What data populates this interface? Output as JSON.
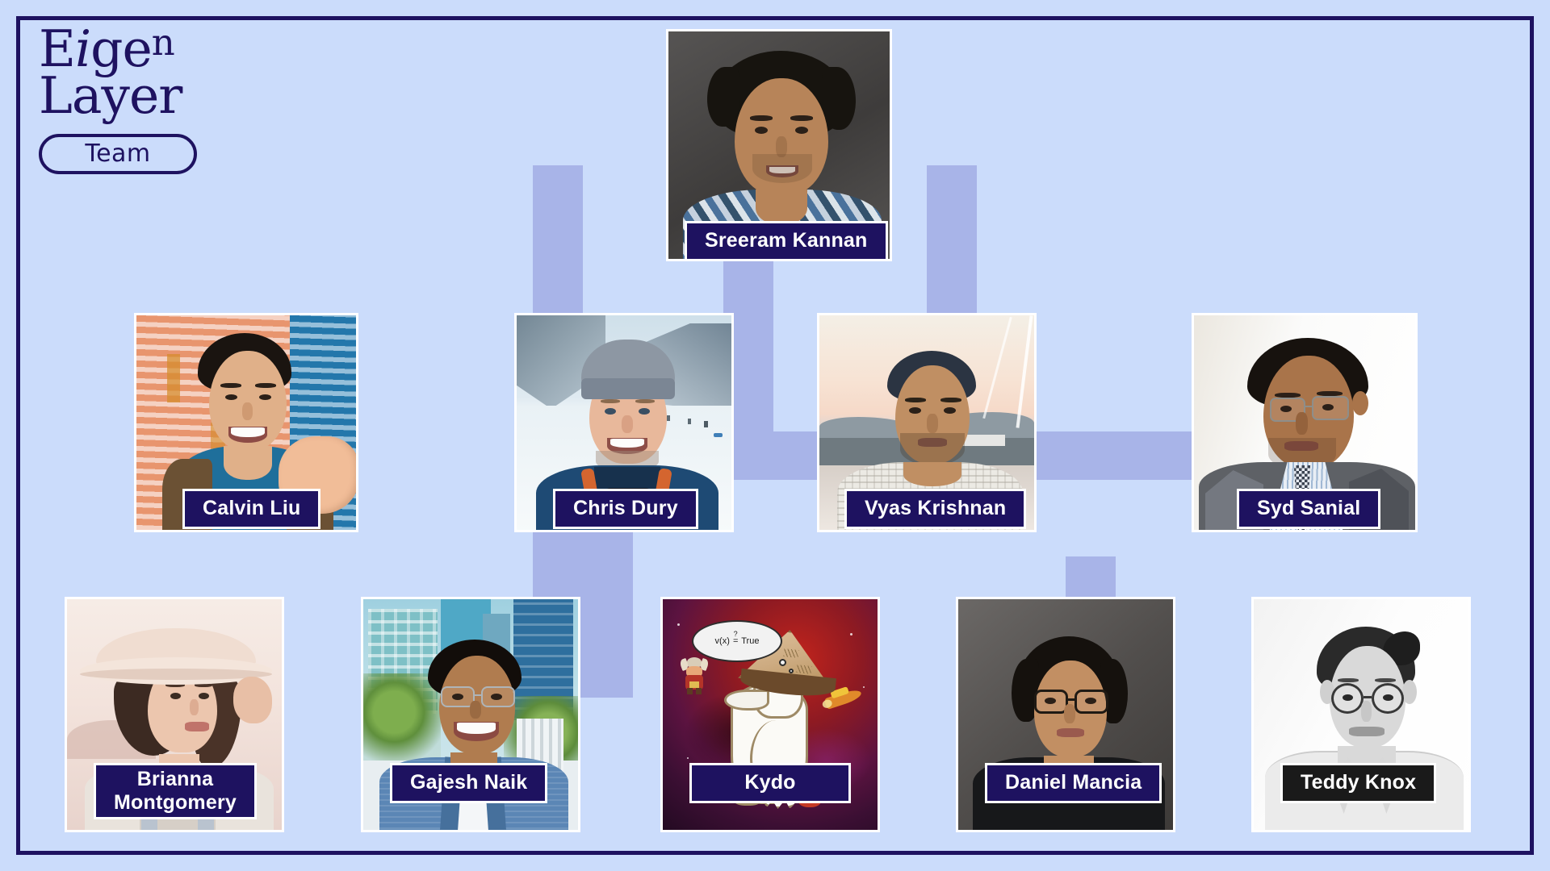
{
  "page": {
    "title": "EigenLayer Team",
    "background_color": "#cbdcfb",
    "frame_color": "#1e1260",
    "connector_color": "#a8b4e8",
    "nameplate_bg": "#1e1260",
    "nameplate_text_color": "#ffffff"
  },
  "logo": {
    "line1_part1": "E",
    "line1_italic_i": "i",
    "line1_part2": "ge",
    "line1_sup_n": "n",
    "line2_part1": "La",
    "line2_sup_y": "y",
    "line2_part2": "er",
    "pill_label": "Team"
  },
  "chart_data": {
    "type": "diagram",
    "title": "EigenLayer Team",
    "layout": "org-chart",
    "levels": 3,
    "nodes": [
      {
        "name": "Sreeram Kannan",
        "level": 1,
        "label_lines": [
          "Sreeram Kannan"
        ]
      },
      {
        "name": "Calvin Liu",
        "level": 2,
        "label_lines": [
          "Calvin Liu"
        ]
      },
      {
        "name": "Chris Dury",
        "level": 2,
        "label_lines": [
          "Chris Dury"
        ]
      },
      {
        "name": "Vyas Krishnan",
        "level": 2,
        "label_lines": [
          "Vyas Krishnan"
        ]
      },
      {
        "name": "Syd Sanial",
        "level": 2,
        "label_lines": [
          "Syd Sanial"
        ]
      },
      {
        "name": "Brianna Montgomery",
        "level": 3,
        "label_lines": [
          "Brianna",
          "Montgomery"
        ]
      },
      {
        "name": "Gajesh Naik",
        "level": 3,
        "label_lines": [
          "Gajesh Naik"
        ]
      },
      {
        "name": "Kydo",
        "level": 3,
        "label_lines": [
          "Kydo"
        ]
      },
      {
        "name": "Daniel Mancia",
        "level": 3,
        "label_lines": [
          "Daniel Mancia"
        ]
      },
      {
        "name": "Teddy Knox",
        "level": 3,
        "label_lines": [
          "Teddy Knox"
        ]
      }
    ]
  },
  "members": {
    "sreeram": {
      "label": "Sreeram Kannan"
    },
    "calvin": {
      "label": "Calvin Liu"
    },
    "chris": {
      "label": "Chris Dury"
    },
    "vyas": {
      "label": "Vyas Krishnan"
    },
    "syd": {
      "label": "Syd Sanial"
    },
    "brianna": {
      "label": "Brianna\nMontgomery"
    },
    "gajesh": {
      "label": "Gajesh Naik"
    },
    "kydo": {
      "label": "Kydo"
    },
    "daniel": {
      "label": "Daniel Mancia"
    },
    "teddy": {
      "label": "Teddy Knox"
    }
  },
  "kydo_avatar": {
    "speech_expr_left": "v(x) ",
    "speech_qmark": "?",
    "speech_eq": "=",
    "speech_expr_right": " True"
  }
}
